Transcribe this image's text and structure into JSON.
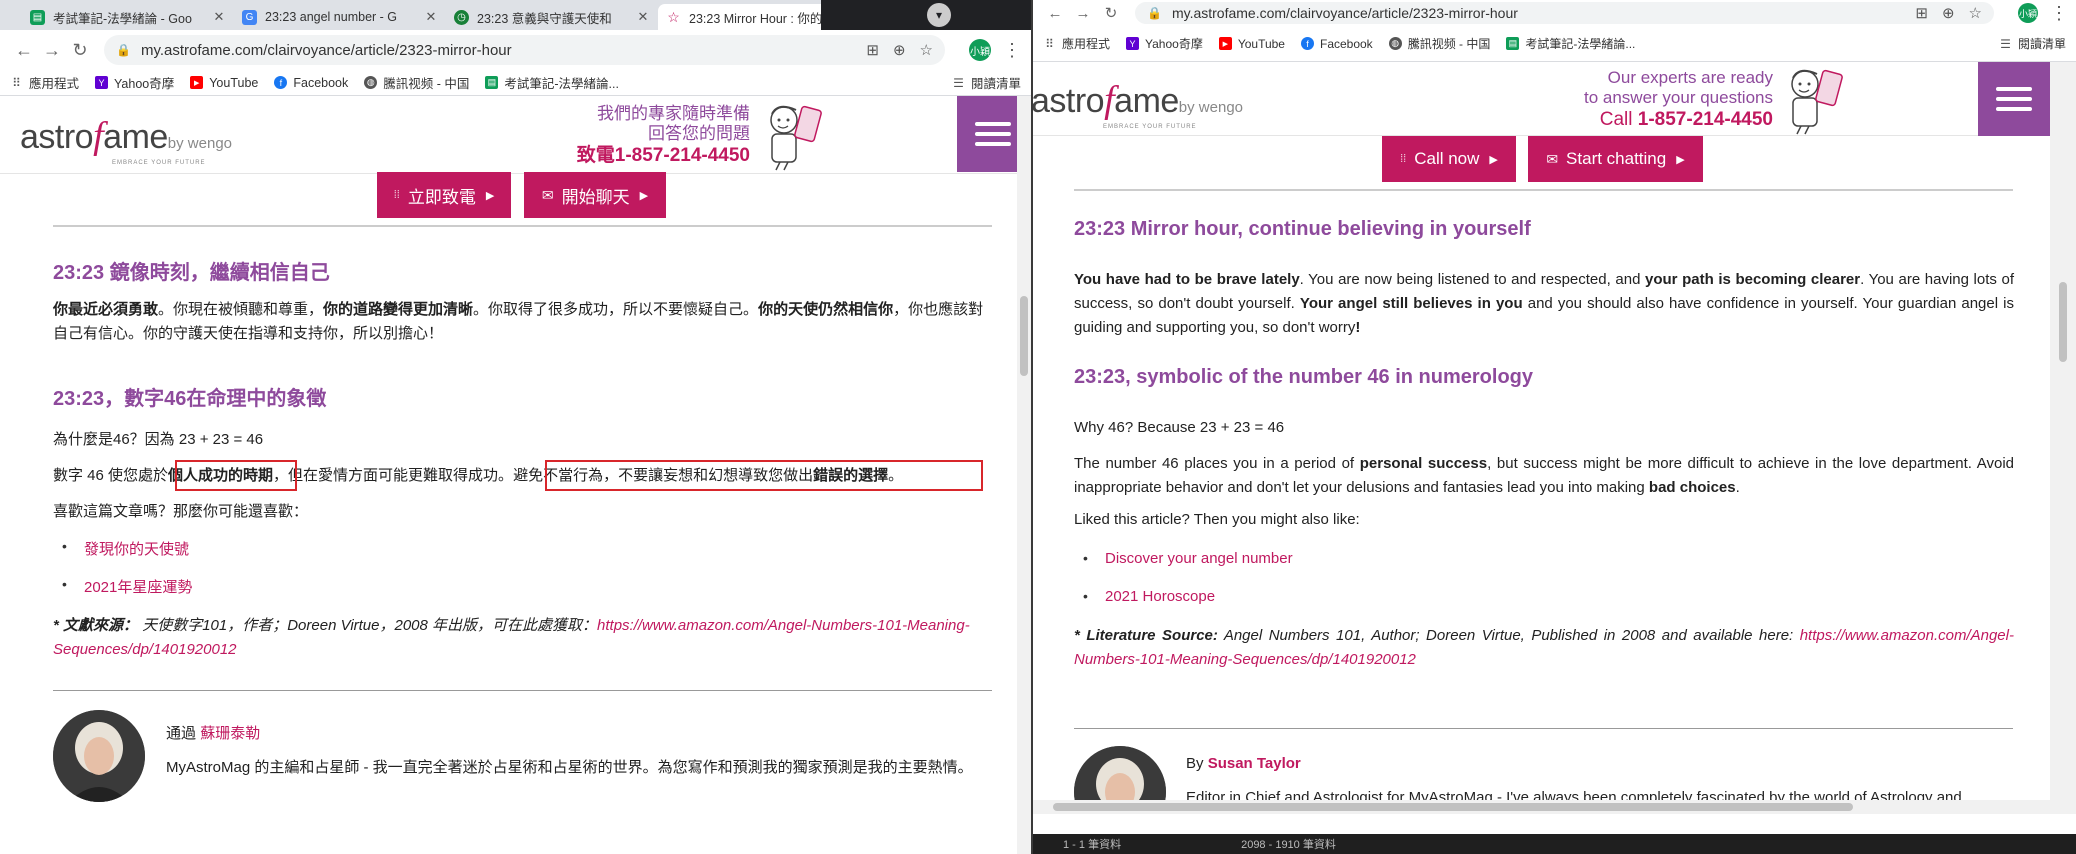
{
  "left": {
    "tabs": [
      {
        "title": "考試筆記-法學緒論 - Goo",
        "color": "#0f9d58"
      },
      {
        "title": "23:23 angel number - G",
        "color": "#4285f4"
      },
      {
        "title": "23:23 意義與守護天使和",
        "color": "#188038"
      },
      {
        "title": "23:23 Mirror Hour : 你的",
        "color": "#c0195f"
      }
    ],
    "url": "my.astrofame.com/clairvoyance/article/2323-mirror-hour",
    "avatar": "小穎",
    "bookmarks": [
      "應用程式",
      "Yahoo奇摩",
      "YouTube",
      "Facebook",
      "騰訊视频 - 中国",
      "考試筆記-法學緒論..."
    ],
    "reading_list": "閱讀清單",
    "header": {
      "line1": "我們的專家隨時準備",
      "line2": "回答您的問題",
      "call_prefix": "致電",
      "phone": "1-857-214-4450"
    },
    "cta": {
      "call": "立即致電",
      "chat": "開始聊天"
    },
    "h1": "23:23 鏡像時刻，繼續相信自己",
    "p1": {
      "a": "你最近必須勇敢",
      "b": "。你現在被傾聽和尊重，",
      "c": "你的道路變得更加清晰",
      "d": "。你取得了很多成功，所以不要懷疑自己。",
      "e": "你的天使仍然相信你",
      "f": "，你也應該對自己有信心。你的守護天使在指導和支持你，所以別擔心！"
    },
    "h2": "23:23，數字46在命理中的象徵",
    "p2": "為什麼是46？因為 23 + 23 = 46",
    "p3": {
      "a": "數字 46 使您處於",
      "b": "個人成功的時期",
      "c": "，但在愛情方面可能更難取得成功。",
      "d": "避免不當行為，不要讓妄想和幻想導致您做出",
      "e": "錯誤的選擇",
      "f": "。"
    },
    "p4": "喜歡這篇文章嗎？那麼你可能還喜歡：",
    "links": [
      "發現你的天使號",
      "2021年星座運勢"
    ],
    "source": {
      "label": "* 文獻來源：",
      "text": "天使數字101，作者；Doreen Virtue，2008 年出版，可在此處獲取：",
      "url": "https://www.amazon.com/Angel-Numbers-101-Meaning-Sequences/dp/1401920012"
    },
    "author": {
      "prefix": "通過",
      "name": "蘇珊泰勒",
      "bio": "MyAstroMag 的主編和占星師 - 我一直完全著迷於占星術和占星術的世界。為您寫作和預測我的獨家預測是我的主要熱情。"
    }
  },
  "right": {
    "url": "my.astrofame.com/clairvoyance/article/2323-mirror-hour",
    "avatar": "小穎",
    "bookmarks": [
      "應用程式",
      "Yahoo奇摩",
      "YouTube",
      "Facebook",
      "騰訊视频 - 中国",
      "考試筆記-法學緒論..."
    ],
    "reading_list": "閱讀清單",
    "header": {
      "line1": "Our experts are ready",
      "line2": "to answer your questions",
      "call_prefix": "Call",
      "phone": "1-857-214-4450"
    },
    "cta": {
      "call": "Call now",
      "chat": "Start chatting"
    },
    "h1": "23:23 Mirror hour, continue believing in yourself",
    "p1": {
      "a": "You have had to be brave lately",
      "b": ". You are now being listened to and respected, and ",
      "c": "your path is becoming clearer",
      "d": ". You are having lots of success, so don't doubt yourself. ",
      "e": "Your angel still believes in you",
      "f": " and you should also have confidence in yourself. Your guardian angel is guiding and supporting you, so don't worry",
      "g": "!"
    },
    "h2": "23:23, symbolic of the number 46 in numerology",
    "p2": "Why 46? Because 23 + 23 = 46",
    "p3": {
      "a": "The number 46 places you in a period of ",
      "b": "personal success",
      "c": ", but success might be more difficult to achieve in the love department. Avoid inappropriate behavior and don't let your delusions and fantasies lead you into making ",
      "d": "bad choices",
      "e": "."
    },
    "p4": "Liked this article? Then you might also like:",
    "links": [
      "Discover your angel number",
      "2021 Horoscope"
    ],
    "source": {
      "label": "* Literature Source:",
      "text": "Angel Numbers 101, Author; Doreen Virtue, Published in 2008 and available here:",
      "url": "https://www.amazon.com/Angel-Numbers-101-Meaning-Sequences/dp/1401920012"
    },
    "author": {
      "prefix": "By",
      "name": "Susan Taylor",
      "bio": "Editor in Chief and Astrologist for MyAstroMag - I've always been completely fascinated by the world of Astrology and horoscopes. Writing for you and forecasting my exclusive predictions are my main passions."
    },
    "taskbar": [
      "1 - 1 筆資料",
      "2098 - 1910 筆資料"
    ]
  },
  "brand": {
    "logo_a": "astro",
    "logo_f": "f",
    "logo_b": "ame",
    "wengo": "by wengo",
    "tagline": "EMBRACE YOUR FUTURE"
  },
  "colors": {
    "brand_pink": "#c0195f",
    "brand_purple": "#8e4a9c",
    "highlight_box": "#d8262b"
  }
}
